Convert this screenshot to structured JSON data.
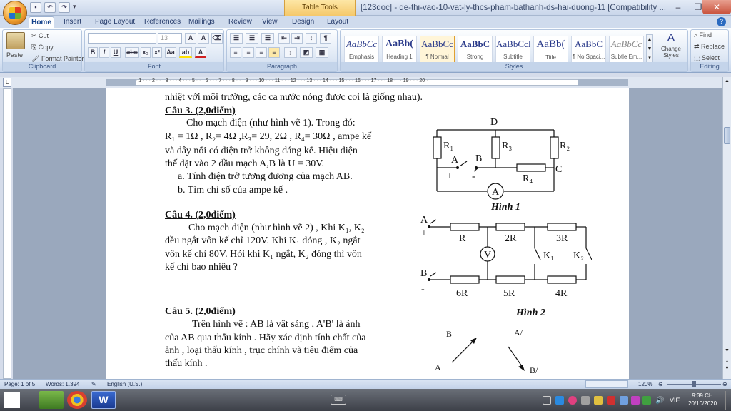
{
  "window": {
    "title": "[123doc] - de-thi-vao-10-vat-ly-thcs-pham-bathanh-ds-hai-duong-11 [Compatibility ...",
    "context_tab": "Table Tools"
  },
  "tabs": [
    "Home",
    "Insert",
    "Page Layout",
    "References",
    "Mailings",
    "Review",
    "View",
    "Design",
    "Layout"
  ],
  "clipboard": {
    "paste": "Paste",
    "cut": "Cut",
    "copy": "Copy",
    "painter": "Format Painter",
    "label": "Clipboard"
  },
  "font": {
    "name": "",
    "size": "13",
    "label": "Font"
  },
  "paragraph": {
    "label": "Paragraph"
  },
  "styles": {
    "label": "Styles",
    "change": "Change Styles",
    "items": [
      {
        "sample": "AaBbCc",
        "name": "Emphasis"
      },
      {
        "sample": "AaBb(",
        "name": "Heading 1"
      },
      {
        "sample": "AaBbCc",
        "name": "¶ Normal"
      },
      {
        "sample": "AaBbC",
        "name": "Strong"
      },
      {
        "sample": "AaBbCcI",
        "name": "Subtitle"
      },
      {
        "sample": "AaBb(",
        "name": "Title"
      },
      {
        "sample": "AaBbC",
        "name": "¶ No Spaci..."
      },
      {
        "sample": "AaBbCc",
        "name": "Subtle Em..."
      }
    ]
  },
  "editing": {
    "find": "Find",
    "replace": "Replace",
    "select": "Select",
    "label": "Editing"
  },
  "ruler_numbers": "· 1 · · · 2 · · · 3 · · · 4 · · · 5 · · · 6 · · · 7 · · · 8 · · · 9 · · · 10 · · · 11 · · · 12 · · · 13 · · · 14 · · · 15 · · · 16 · · · 17 · · · 18 · · · 19 · · · 20 ·",
  "doc": {
    "line0": "nhiệt với môi trường, các ca nước nóng được coi là giống nhau).",
    "q3_head": "Câu 3. (2,0điểm)",
    "q3_1": "Cho mạch điện (như hình vẽ 1). Trong đó:",
    "q3_2": "R₁ = 1Ω , R₂= 4Ω ,R₃= 29, 2Ω , R₄= 30Ω , ampe kế",
    "q3_3": "và dây nối có điện trở không đáng kể. Hiệu điện",
    "q3_4": "thế đặt vào 2 đầu mạch A,B là U = 30V.",
    "q3_a": "a. Tính điện trở tương đương của  mạch AB.",
    "q3_b": "b. Tìm chỉ số của ampe kế .",
    "q4_head": "Câu 4. (2,0điểm)",
    "q4_1": "Cho mạch điện (như hình vẽ 2) , Khi K₁, K₂",
    "q4_2": "đều ngắt vôn kế chỉ 120V. Khi K₁ đóng , K₂ ngắt",
    "q4_3": "vôn kế chỉ 80V. Hỏi khi K₁ ngắt, K₂ đóng thì vôn",
    "q4_4": "kế  chỉ bao nhiêu ?",
    "q5_head": "Câu 5. (2,0điểm)",
    "q5_1": "Trên hình  vẽ : AB là vật sáng , A'B' là ảnh",
    "q5_2": "của AB qua thấu kính . Hãy  xác định tính chất của",
    "q5_3": "ảnh , loại thấu kính , trục chính và tiêu điểm của",
    "q5_4": "thấu kính ."
  },
  "fig1": {
    "caption": "Hình 1",
    "D": "D",
    "R1": "R₁",
    "R3": "R₃",
    "R2": "R₂",
    "A": "A",
    "B": "B",
    "C": "C",
    "R4": "R₄",
    "plus": "+",
    "minus": "-",
    "ammeter": "A"
  },
  "fig2": {
    "caption": "Hình 2",
    "A": "A",
    "B": "B",
    "plus": "+",
    "minus": "-",
    "R": "R",
    "R2": "2R",
    "R3": "3R",
    "R6": "6R",
    "R5": "5R",
    "R4": "4R",
    "V": "V",
    "K1": "K₁",
    "K2": "K₂"
  },
  "fig3": {
    "B": "B",
    "A2": "A/",
    "A": "A",
    "B2": "B/"
  },
  "status": {
    "page": "Page: 1 of 5",
    "words": "Words: 1.394",
    "lang": "English (U.S.)",
    "zoom": "120%"
  },
  "taskbar": {
    "lang": "VIE",
    "time": "9:39 CH",
    "date": "20/10/2020"
  }
}
